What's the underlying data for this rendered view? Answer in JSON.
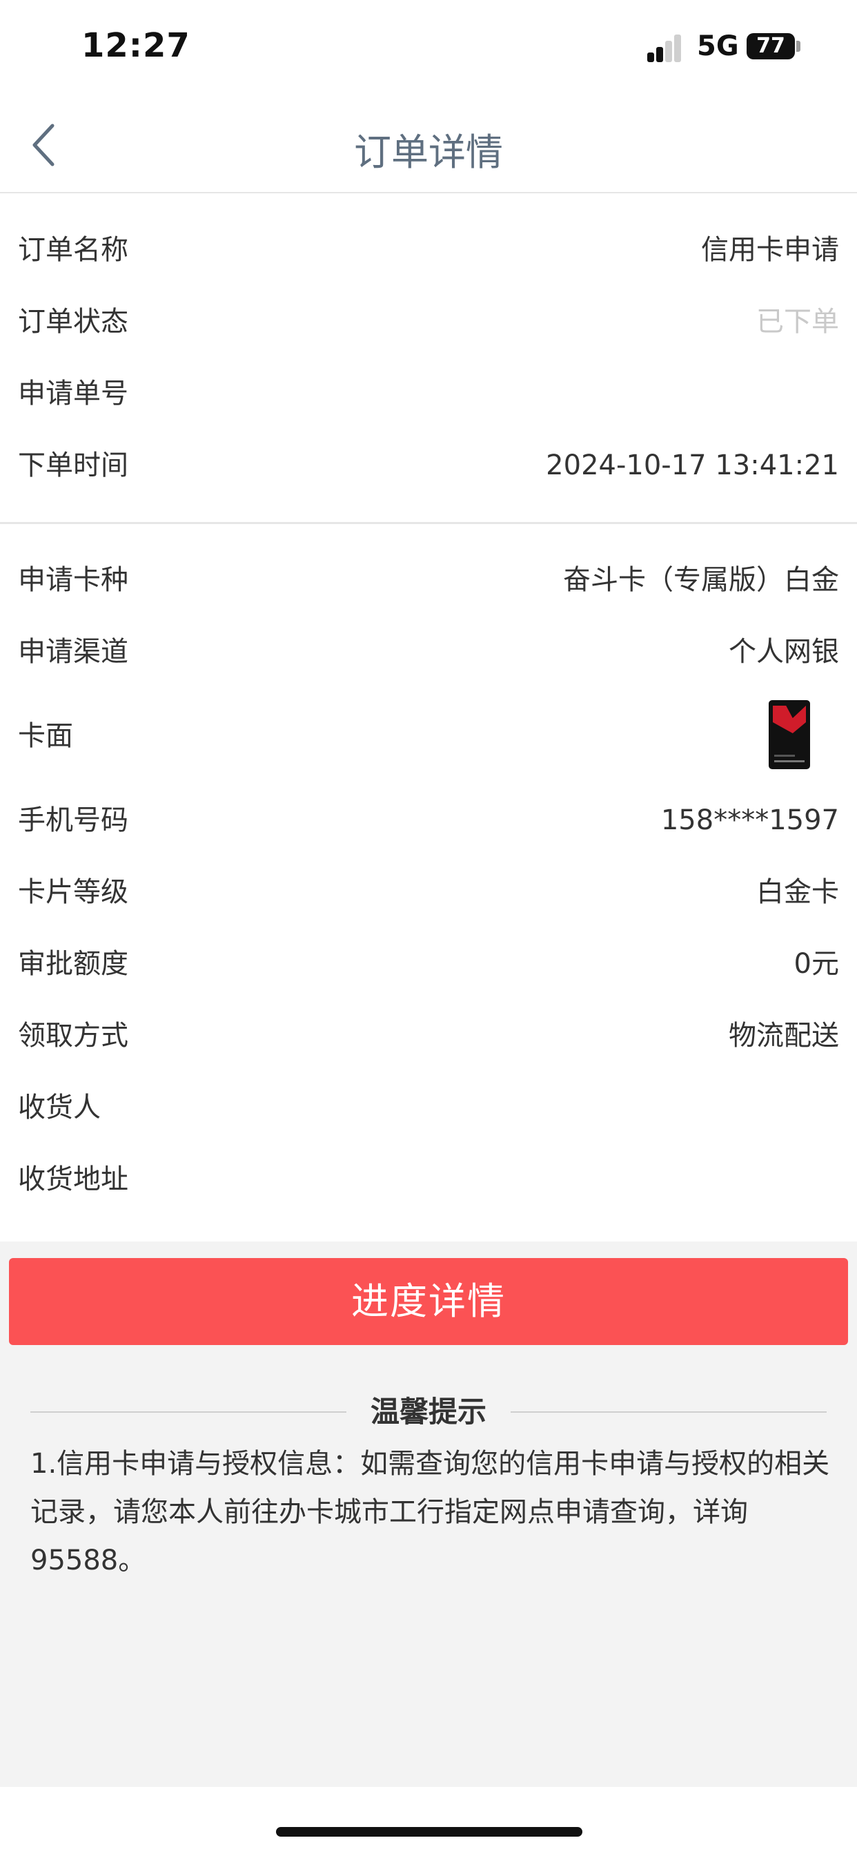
{
  "status_bar": {
    "time": "12:27",
    "network": "5G",
    "battery": "77"
  },
  "nav": {
    "title": "订单详情",
    "back_icon": "chevron-left-icon"
  },
  "order_info": [
    {
      "label": "订单名称",
      "value": "信用卡申请"
    },
    {
      "label": "订单状态",
      "value": "已下单"
    },
    {
      "label": "申请单号",
      "value": ""
    },
    {
      "label": "下单时间",
      "value": "2024-10-17 13:41:21"
    }
  ],
  "card_info": {
    "card_type": {
      "label": "申请卡种",
      "value": "奋斗卡（专属版）白金"
    },
    "channel": {
      "label": "申请渠道",
      "value": "个人网银"
    },
    "card_face": {
      "label": "卡面"
    },
    "phone": {
      "label": "手机号码",
      "value": "158****1597"
    },
    "level": {
      "label": "卡片等级",
      "value": "白金卡"
    },
    "credit_limit": {
      "label": "审批额度",
      "value": "0元"
    },
    "delivery": {
      "label": "领取方式",
      "value": "物流配送"
    },
    "recipient": {
      "label": "收货人",
      "value": ""
    },
    "address": {
      "label": "收货地址",
      "value": ""
    }
  },
  "actions": {
    "progress_button": "进度详情"
  },
  "tips": {
    "title": "温馨提示",
    "text": "1.信用卡申请与授权信息：如需查询您的信用卡申请与授权的相关记录，请您本人前往办卡城市工行指定网点申请查询，详询95588。"
  },
  "colors": {
    "primary_button": "#fb5254",
    "nav_title": "#5f6f80",
    "background_grey": "#f3f3f3"
  }
}
